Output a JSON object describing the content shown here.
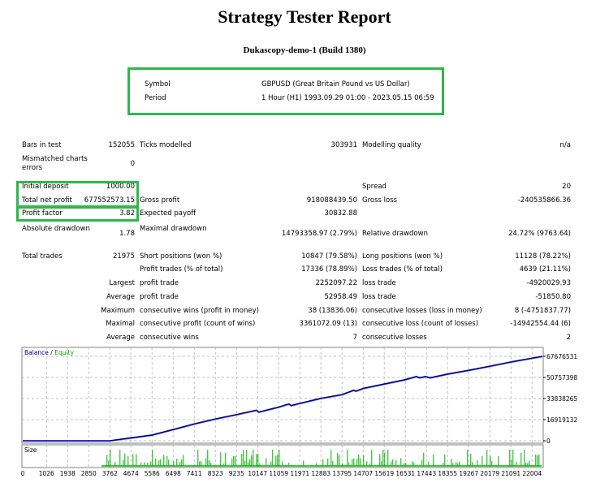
{
  "title": "Strategy Tester Report",
  "subtitle": "Dukascopy-demo-1 (Build 1380)",
  "settings": [
    {
      "label": "Symbol",
      "value": "GBPUSD (Great Britain Pound vs US Dollar)"
    },
    {
      "label": "Period",
      "value": "1 Hour (H1) 1993.09.29 01:00 - 2023.05.15 06:59"
    }
  ],
  "highlight_color": "#2db84d",
  "rows": [
    [
      "Bars in test",
      "152055",
      "Ticks modelled",
      "303931",
      "Modelling quality",
      "n/a"
    ],
    [
      "Mismatched charts errors",
      "0",
      "",
      "",
      "",
      ""
    ],
    [
      "Initial deposit",
      "1000.00",
      "",
      "",
      "Spread",
      "20"
    ],
    [
      "Total net profit",
      "677552573.15",
      "Gross profit",
      "918088439.50",
      "Gross loss",
      "-240535866.36"
    ],
    [
      "Profit factor",
      "3.82",
      "Expected payoff",
      "30832.88",
      "",
      ""
    ],
    [
      "Absolute drawdown",
      "1.78",
      "Maximal drawdown",
      "14793358.97 (2.79%)",
      "Relative drawdown",
      "24.72% (9763.64)"
    ],
    [
      "Total trades",
      "21975",
      "Short positions (won %)",
      "10847 (79.58%)",
      "Long positions (won %)",
      "11128 (78.22%)"
    ],
    [
      "",
      "",
      "Profit trades (% of total)",
      "17336 (78.89%)",
      "Loss trades (% of total)",
      "4639 (21.11%)"
    ],
    [
      "",
      "Largest",
      "profit trade",
      "2252097.22",
      "loss trade",
      "-4920029.93"
    ],
    [
      "",
      "Average",
      "profit trade",
      "52958.49",
      "loss trade",
      "-51850.80"
    ],
    [
      "",
      "Maximum",
      "consecutive wins (profit in money)",
      "38 (13836.06)",
      "consecutive losses (loss in money)",
      "8 (-4751837.77)"
    ],
    [
      "",
      "Maximal",
      "consecutive profit (count of wins)",
      "3361072.09 (13)",
      "consecutive loss (count of losses)",
      "-14942554.44 (6)"
    ],
    [
      "",
      "Average",
      "consecutive wins",
      "7",
      "consecutive losses",
      "2"
    ]
  ],
  "chart_data": {
    "type": "line",
    "legend": [
      "Balance",
      "Equity"
    ],
    "colors": {
      "balance": "#000080",
      "equity": "#00b000",
      "size": "#00b000",
      "grid": "#c0c0c0"
    },
    "y_ticks": [
      "67676531",
      "50757398",
      "33838265",
      "16919132",
      "0"
    ],
    "ylim": [
      0,
      67676531
    ],
    "x_ticks": [
      "0",
      "1026",
      "1938",
      "2850",
      "3762",
      "4674",
      "5586",
      "6498",
      "7411",
      "8323",
      "9235",
      "10147",
      "11059",
      "11971",
      "12883",
      "13795",
      "14707",
      "15619",
      "16531",
      "17443",
      "18355",
      "19267",
      "20179",
      "21091",
      "22004"
    ],
    "xlim": [
      0,
      22450
    ],
    "balance": {
      "x": [
        0,
        3762,
        4674,
        5586,
        6498,
        7411,
        8323,
        9235,
        10100,
        10200,
        11059,
        11500,
        11600,
        11971,
        12883,
        13795,
        14300,
        14400,
        14707,
        15619,
        16531,
        17000,
        17150,
        17400,
        17600,
        18355,
        19267,
        20179,
        21091,
        22004,
        22450
      ],
      "y": [
        0,
        0,
        2300000,
        4600000,
        9000000,
        13500000,
        17500000,
        21000000,
        24500000,
        23000000,
        27000000,
        29500000,
        28200000,
        30000000,
        34000000,
        37000000,
        40500000,
        39800000,
        42000000,
        45500000,
        49000000,
        51500000,
        50500000,
        51500000,
        50500000,
        53500000,
        56500000,
        59800000,
        63200000,
        66200000,
        67676531
      ]
    },
    "size_panel_label": "Size"
  }
}
